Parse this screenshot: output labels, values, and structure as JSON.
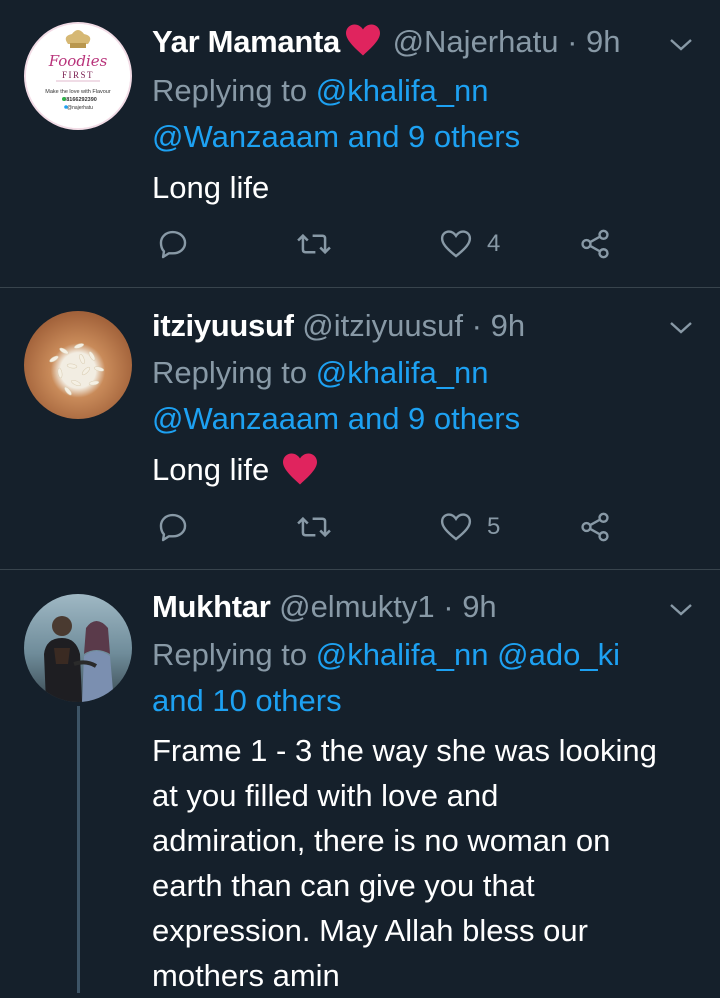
{
  "tweets": [
    {
      "name": "Yar Mamanta",
      "name_emoji": "heart",
      "handle": "@Najerhatu",
      "time": "9h",
      "replying_prefix": "Replying to",
      "replying_to_line1": "@khalifa_nn",
      "replying_to_line2": "@Wanzaaam and 9 others",
      "text": "Long life",
      "likes": "4",
      "avatar": {
        "brand": "Foodies",
        "brand2": "FIRST",
        "tagline": "Make the love with Flavour",
        "phone": "08166292390",
        "social": "@najerhatu"
      }
    },
    {
      "name": "itziyuusuf",
      "handle": "@itziyuusuf",
      "time": "9h",
      "replying_prefix": "Replying to",
      "replying_to_line1": "@khalifa_nn",
      "replying_to_line2": "@Wanzaaam and 9 others",
      "text": "Long life",
      "likes": "5"
    },
    {
      "name": "Mukhtar",
      "handle": "@elmukty1",
      "time": "9h",
      "replying_prefix": "Replying to",
      "replying_to_line1": "@khalifa_nn @ado_ki",
      "replying_to_line2": "and 10 others",
      "text_lines": [
        "Frame 1 - 3 the way she was looking",
        "at you filled with love and",
        "admiration, there is no woman on",
        "earth than can give you that",
        "expression. May Allah bless our",
        "mothers amin"
      ]
    }
  ],
  "separator": "·",
  "colors": {
    "background": "#15202b",
    "link": "#1da1f2",
    "secondary_text": "#8899a6",
    "heart": "#e0245e",
    "divider": "#38444d"
  },
  "icons": [
    "reply-icon",
    "retweet-icon",
    "like-icon",
    "share-icon",
    "chevron-down-icon",
    "heart-emoji"
  ]
}
